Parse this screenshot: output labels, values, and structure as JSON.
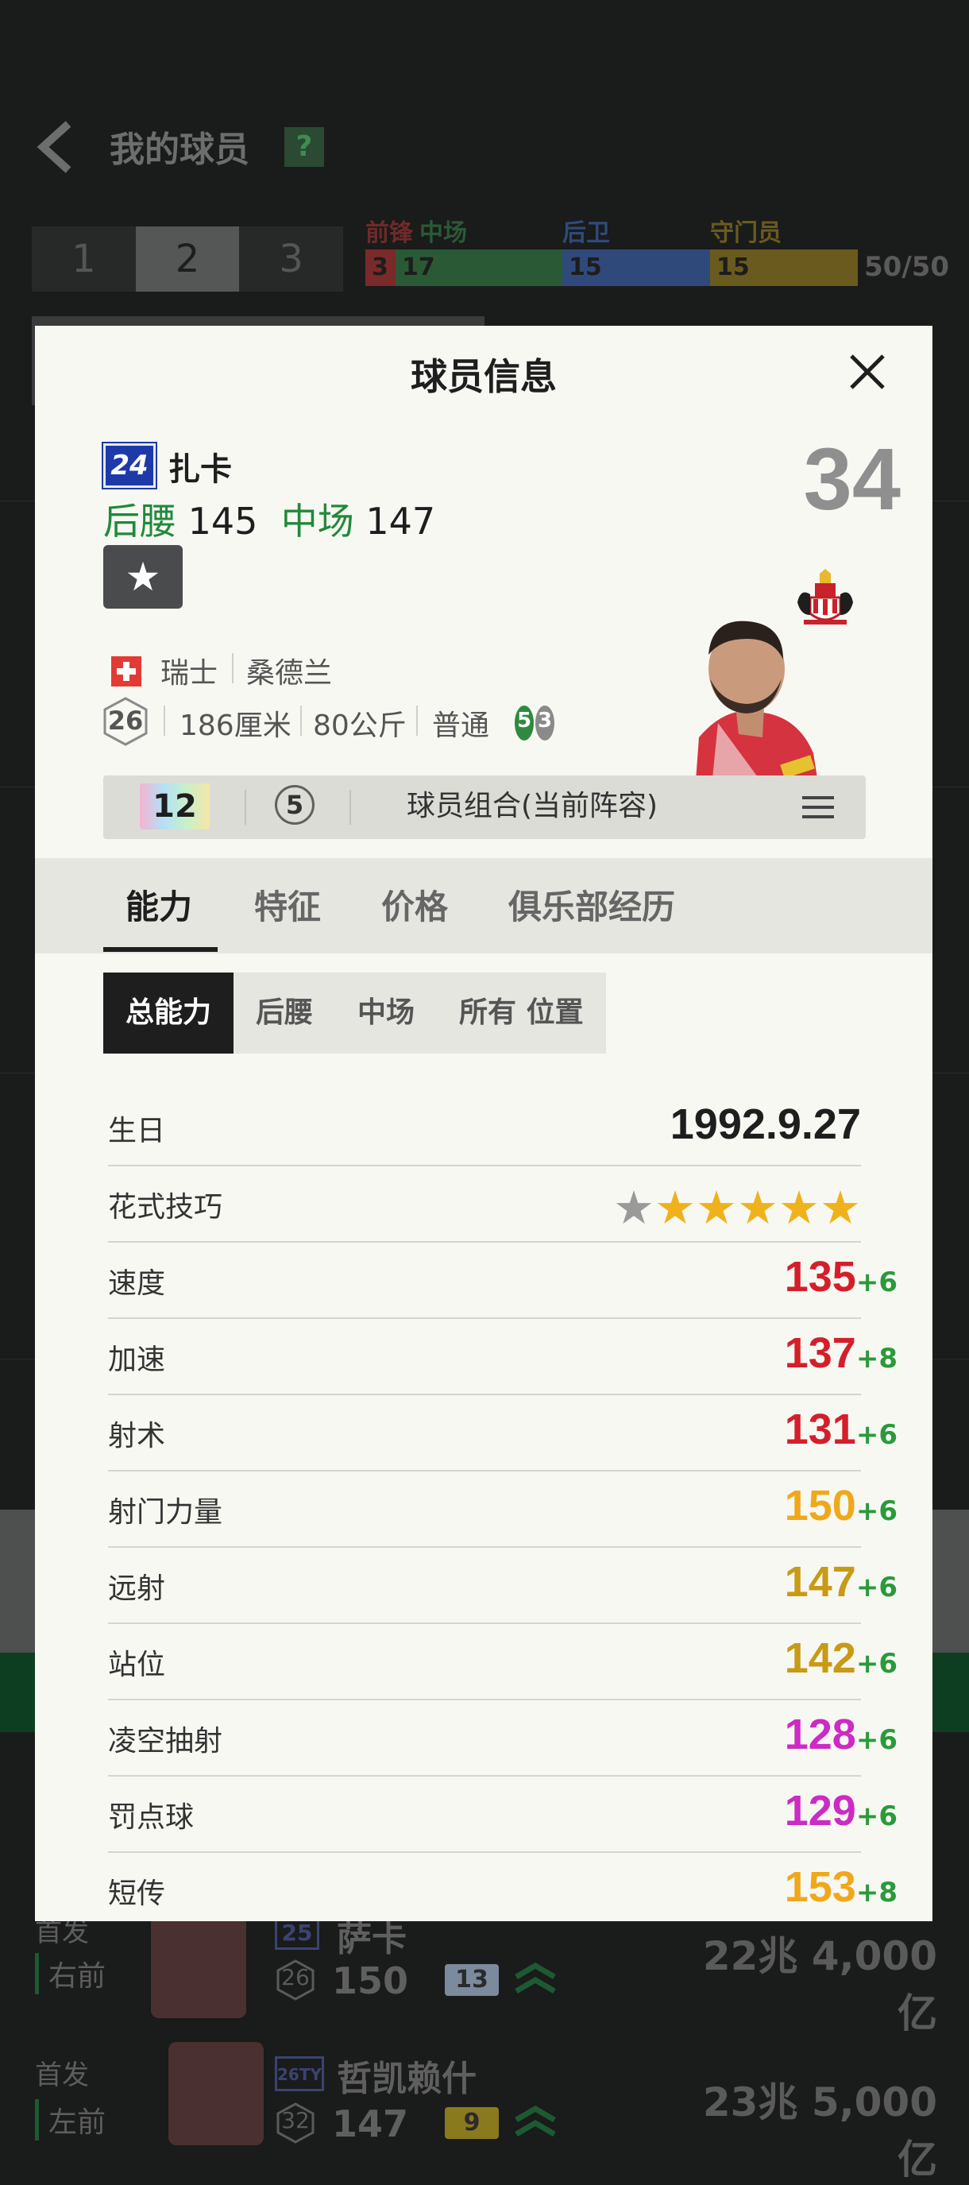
{
  "background": {
    "title": "我的球员",
    "help": "?",
    "squad_tabs": [
      "1",
      "2",
      "3"
    ],
    "position_labels": {
      "forward": "前锋",
      "mid": "中场",
      "def": "后卫",
      "gk": "守门员"
    },
    "position_counts": [
      "3",
      "17",
      "15",
      "15"
    ],
    "capacity": "50/50",
    "rows": [
      {
        "role": "首发",
        "position": "右前",
        "badge": "25",
        "name": "萨卡",
        "age": "26",
        "rating": "150",
        "boost": "13",
        "value": "22兆 4,000亿"
      },
      {
        "role": "首发",
        "position": "左前",
        "badge": "26TY",
        "name": "哲凯赖什",
        "age": "32",
        "rating": "147",
        "boost": "9",
        "value": "23兆 5,000亿"
      }
    ]
  },
  "modal": {
    "title": "球员信息",
    "player": {
      "season_badge": "24",
      "name": "扎卡",
      "pos1_name": "后腰",
      "pos1_rating": "145",
      "pos2_name": "中场",
      "pos2_rating": "147",
      "overall": "34",
      "nation": "瑞士",
      "club": "桑德兰",
      "age": "26",
      "height": "186厘米",
      "weight": "80公斤",
      "body_type": "普通",
      "left_foot": "5",
      "right_foot": "3"
    },
    "chemistry": {
      "level": "12",
      "count": "5",
      "label": "球员组合(当前阵容)"
    },
    "tabs": [
      "能力",
      "特征",
      "价格",
      "俱乐部经历"
    ],
    "sub_tabs": [
      "总能力",
      "后腰",
      "中场",
      "所有 位置"
    ],
    "birthday_label": "生日",
    "birthday": "1992.9.27",
    "skill_moves_label": "花式技巧",
    "skill_moves_stars": 5,
    "stats": [
      {
        "label": "速度",
        "value": "135",
        "bonus": "+6",
        "color": "#d41f2b"
      },
      {
        "label": "加速",
        "value": "137",
        "bonus": "+8",
        "color": "#d41f2b"
      },
      {
        "label": "射术",
        "value": "131",
        "bonus": "+6",
        "color": "#d41f2b"
      },
      {
        "label": "射门力量",
        "value": "150",
        "bonus": "+6",
        "color": "#f0a81b"
      },
      {
        "label": "远射",
        "value": "147",
        "bonus": "+6",
        "color": "#c89a16"
      },
      {
        "label": "站位",
        "value": "142",
        "bonus": "+6",
        "color": "#c89a16"
      },
      {
        "label": "凌空抽射",
        "value": "128",
        "bonus": "+6",
        "color": "#cc2bc4"
      },
      {
        "label": "罚点球",
        "value": "129",
        "bonus": "+6",
        "color": "#cc2bc4"
      },
      {
        "label": "短传",
        "value": "153",
        "bonus": "+8",
        "color": "#f0a81b"
      }
    ]
  }
}
